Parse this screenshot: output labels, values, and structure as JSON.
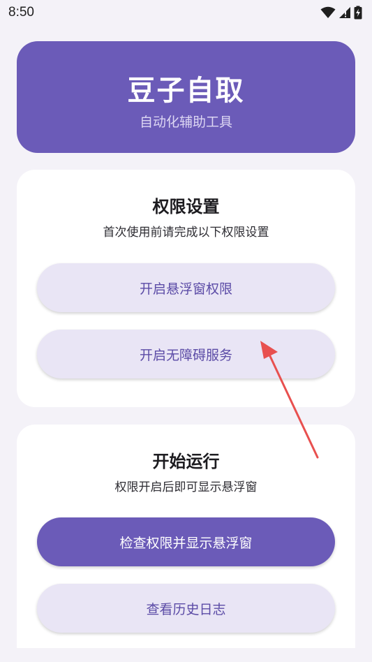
{
  "status_bar": {
    "time": "8:50",
    "icons": [
      "wifi-icon",
      "signal-icon",
      "battery-charging-icon"
    ]
  },
  "header": {
    "title": "豆子自取",
    "subtitle": "自动化辅助工具"
  },
  "permissions": {
    "title": "权限设置",
    "description": "首次使用前请完成以下权限设置",
    "overlay_button": "开启悬浮窗权限",
    "accessibility_button": "开启无障碍服务"
  },
  "run": {
    "title": "开始运行",
    "description": "权限开启后即可显示悬浮窗",
    "check_button": "检查权限并显示悬浮窗",
    "history_button": "查看历史日志"
  },
  "colors": {
    "primary": "#6b5bb8",
    "tonal": "#e9e5f5",
    "background": "#f4f2f8",
    "annotation_arrow": "#e8504f"
  }
}
